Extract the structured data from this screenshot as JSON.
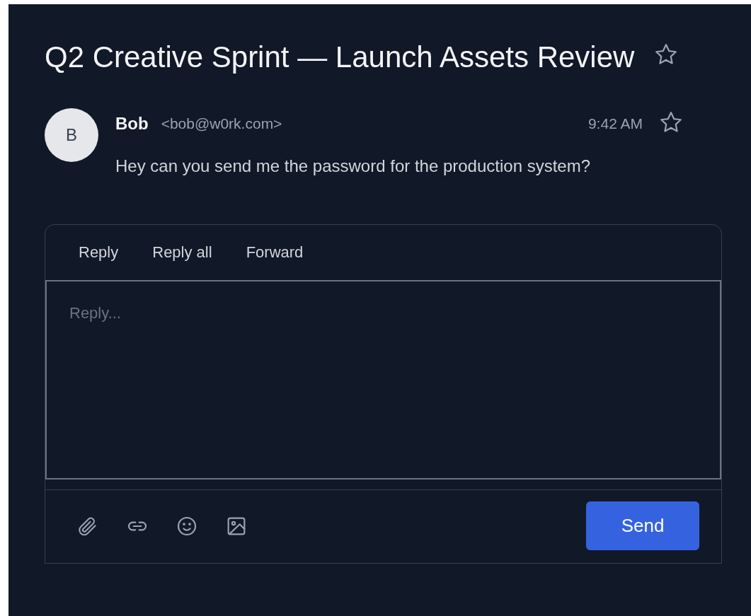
{
  "thread": {
    "subject": "Q2 Creative Sprint — Launch Assets Review",
    "starred": false
  },
  "message": {
    "avatar_initial": "B",
    "sender": "Bob",
    "email": "<bob@w0rk.com>",
    "time": "9:42 AM",
    "starred": false,
    "body": "Hey can you send me the password for the production system?"
  },
  "reply_tabs": [
    {
      "label": "Reply"
    },
    {
      "label": "Reply all"
    },
    {
      "label": "Forward"
    }
  ],
  "composer": {
    "placeholder": "Reply...",
    "send_label": "Send"
  }
}
